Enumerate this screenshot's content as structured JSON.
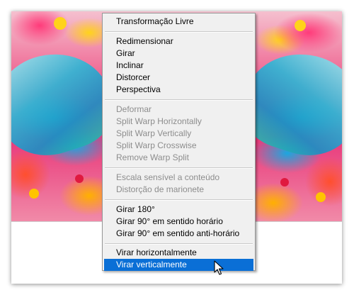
{
  "menu": {
    "group_transform": [
      {
        "key": "free_transform",
        "label": "Transformação Livre",
        "enabled": true
      }
    ],
    "group_basic": [
      {
        "key": "scale",
        "label": "Redimensionar",
        "enabled": true
      },
      {
        "key": "rotate",
        "label": "Girar",
        "enabled": true
      },
      {
        "key": "skew",
        "label": "Inclinar",
        "enabled": true
      },
      {
        "key": "distort",
        "label": "Distorcer",
        "enabled": true
      },
      {
        "key": "perspective",
        "label": "Perspectiva",
        "enabled": true
      }
    ],
    "group_warp": [
      {
        "key": "warp",
        "label": "Deformar",
        "enabled": false
      },
      {
        "key": "split_warp_h",
        "label": "Split Warp Horizontally",
        "enabled": false
      },
      {
        "key": "split_warp_v",
        "label": "Split Warp Vertically",
        "enabled": false
      },
      {
        "key": "split_warp_cross",
        "label": "Split Warp Crosswise",
        "enabled": false
      },
      {
        "key": "remove_warp_split",
        "label": "Remove Warp Split",
        "enabled": false
      }
    ],
    "group_content": [
      {
        "key": "content_aware_scale",
        "label": "Escala sensível a conteúdo",
        "enabled": false
      },
      {
        "key": "puppet_warp",
        "label": "Distorção de marionete",
        "enabled": false
      }
    ],
    "group_rotate": [
      {
        "key": "rotate_180",
        "label": "Girar 180°",
        "enabled": true
      },
      {
        "key": "rotate_90_cw",
        "label": "Girar 90° em sentido horário",
        "enabled": true
      },
      {
        "key": "rotate_90_ccw",
        "label": "Girar 90° em sentido anti-horário",
        "enabled": true
      }
    ],
    "group_flip": [
      {
        "key": "flip_horizontal",
        "label": "Virar horizontalmente",
        "enabled": true
      },
      {
        "key": "flip_vertical",
        "label": "Virar verticalmente",
        "enabled": true,
        "highlighted": true
      }
    ]
  },
  "cursor": {
    "icon": "arrow-cursor-icon"
  },
  "colors": {
    "menu_bg": "#f0f0f0",
    "highlight": "#0a6fd6",
    "disabled_text": "#8d8d8d"
  }
}
